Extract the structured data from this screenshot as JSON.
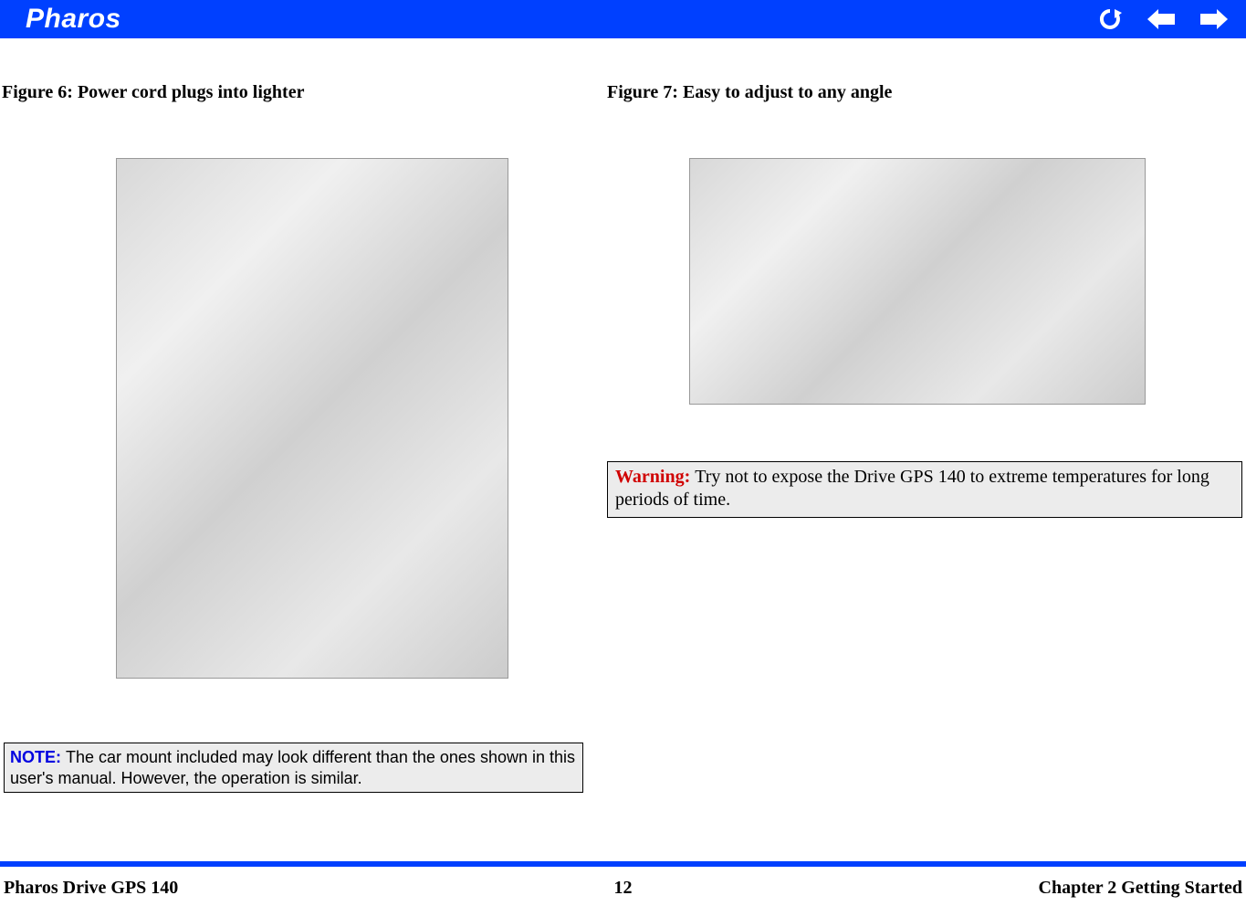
{
  "header": {
    "brand": "Pharos",
    "icons": [
      "refresh-icon",
      "back-icon",
      "forward-icon"
    ]
  },
  "left": {
    "caption": "Figure 6: Power cord plugs into lighter",
    "note_label": "NOTE: ",
    "note_text": "The car mount included may look different than the ones shown in this user's manual. However, the operation is similar."
  },
  "right": {
    "caption": "Figure 7: Easy to adjust to any angle",
    "warn_label": "Warning: ",
    "warn_text": "Try not to expose the Drive GPS 140 to extreme temperatures for long periods of time."
  },
  "footer": {
    "left": "Pharos Drive GPS 140",
    "center": "12",
    "right": "Chapter 2 Getting Started"
  }
}
